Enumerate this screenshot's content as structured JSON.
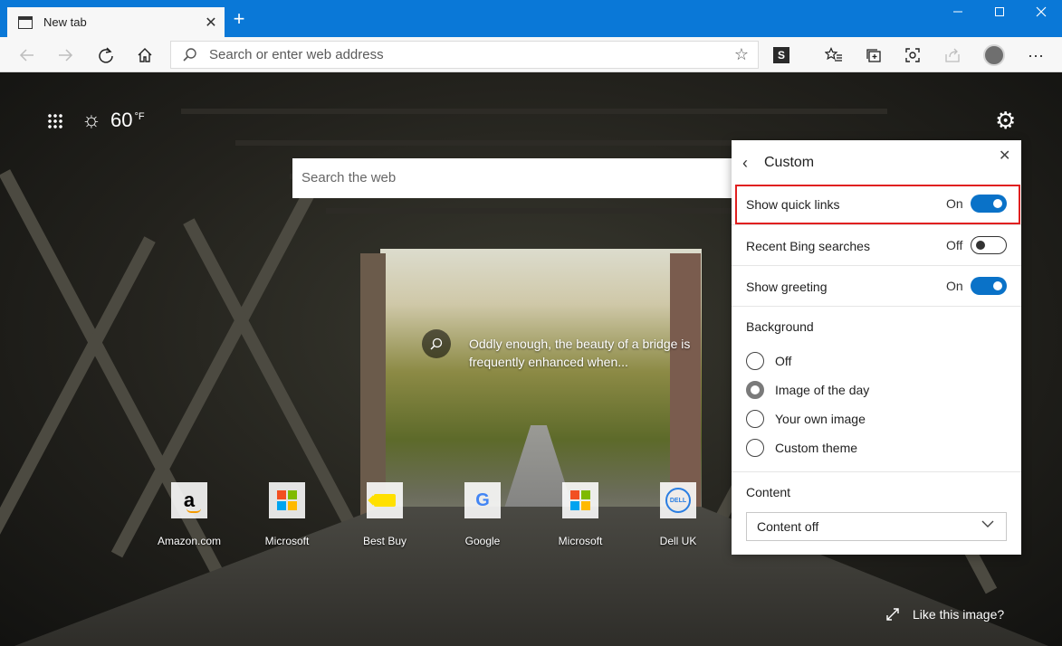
{
  "browser": {
    "tab_title": "New tab",
    "address_placeholder": "Search or enter web address",
    "window_buttons": [
      "minimize",
      "maximize",
      "close"
    ]
  },
  "toolbar": {
    "icons": [
      "back-icon",
      "forward-icon",
      "refresh-icon",
      "home-icon",
      "favorite-star-icon",
      "extension-s-icon",
      "favorites-icon",
      "collections-icon",
      "screenshot-icon",
      "share-icon",
      "profile-avatar",
      "more-icon"
    ],
    "extension_badge": "S"
  },
  "ntp": {
    "weather": {
      "temperature": "60",
      "unit": "°F",
      "icon": "sun-icon"
    },
    "search_placeholder": "Search the web",
    "image_caption": "Oddly enough, the beauty of a bridge is frequently enhanced when...",
    "like_image": "Like this image?",
    "quick_links": [
      {
        "label": "Amazon.com",
        "icon": "amazon-icon"
      },
      {
        "label": "Microsoft",
        "icon": "microsoft-icon"
      },
      {
        "label": "Best Buy",
        "icon": "bestbuy-icon"
      },
      {
        "label": "Google",
        "icon": "google-icon"
      },
      {
        "label": "Microsoft",
        "icon": "microsoft-icon"
      },
      {
        "label": "Dell UK",
        "icon": "dell-icon"
      }
    ]
  },
  "panel": {
    "title": "Custom",
    "toggles": [
      {
        "label": "Show quick links",
        "state": "On",
        "on": true,
        "highlighted": true
      },
      {
        "label": "Recent Bing searches",
        "state": "Off",
        "on": false
      },
      {
        "label": "Show greeting",
        "state": "On",
        "on": true
      }
    ],
    "background_title": "Background",
    "background_options": [
      {
        "label": "Off",
        "checked": false
      },
      {
        "label": "Image of the day",
        "checked": true
      },
      {
        "label": "Your own image",
        "checked": false
      },
      {
        "label": "Custom theme",
        "checked": false
      }
    ],
    "content_title": "Content",
    "content_select_value": "Content off"
  },
  "colors": {
    "accent": "#0a78d7",
    "toggle_on": "#0a72c8",
    "highlight_border": "#e02020",
    "toolbar_bg": "#f7f7f7"
  }
}
